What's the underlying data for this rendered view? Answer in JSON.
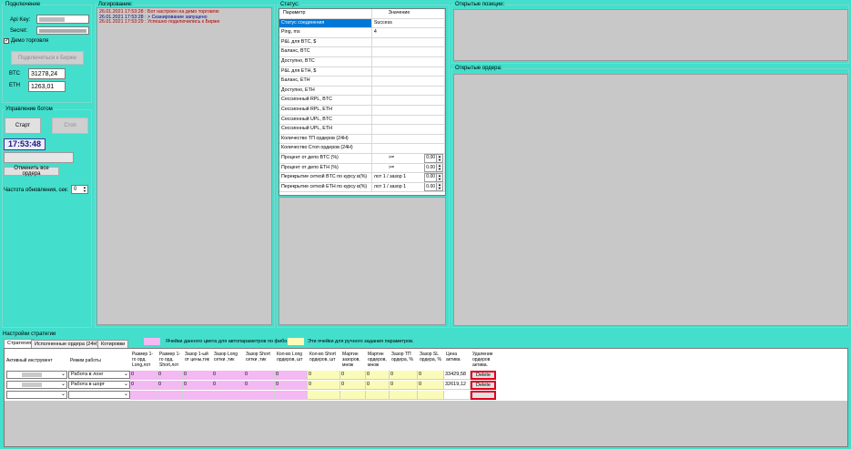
{
  "connection": {
    "title": "Подключение",
    "api_key_label": "Api Key:",
    "secret_label": "Secret:",
    "demo_label": "Демо торговля",
    "connect_button": "Подключиться к Бирже",
    "btc_label": "BTC",
    "btc_value": "31278,24",
    "eth_label": "ETH",
    "eth_value": "1263,01"
  },
  "bot_control": {
    "title": "Управление ботом",
    "start_button": "Старт",
    "stop_button": "Стоп",
    "clock": "17:53:48",
    "cancel_orders_button": "Отменить все ордера",
    "refresh_label": "Частота обновления, сек:",
    "refresh_value": "0"
  },
  "logging": {
    "title": "Логирование:",
    "lines": [
      "26.01.2021 17:53:28 : Бот настроен на демо торговлю",
      "26.01.2021 17:53:28 : > Сканирование запущено",
      "26.01.2021 17:53:29 : Успешно подключились к Бирже"
    ]
  },
  "status": {
    "title": "Статус:",
    "col_param": "Параметр",
    "col_value": "Значение",
    "rows": [
      {
        "param": "Статус соединения",
        "value": "Success",
        "selected": true
      },
      {
        "param": "Ping, ms",
        "value": "4"
      },
      {
        "param": "P&L для BTC, $",
        "value": ""
      },
      {
        "param": "Баланс, BTC",
        "value": ""
      },
      {
        "param": "Доступно, BTC",
        "value": ""
      },
      {
        "param": "P&L для ETH, $",
        "value": ""
      },
      {
        "param": "Баланс, ETH",
        "value": ""
      },
      {
        "param": "Доступно, ETH",
        "value": ""
      },
      {
        "param": "Сессионный RPL, BTC",
        "value": ""
      },
      {
        "param": "Сессионный RPL, ETH",
        "value": ""
      },
      {
        "param": "Сессионный UPL, BTC",
        "value": ""
      },
      {
        "param": "Сессионный UPL, ETH",
        "value": ""
      },
      {
        "param": "Количество ТП ордеров (24Н)",
        "value": ""
      },
      {
        "param": "Количество Стоп ордеров (24Н)",
        "value": ""
      },
      {
        "param": "Процент от депо BTC (%)",
        "value": ">=",
        "spin": "0.00"
      },
      {
        "param": "Процент от депо  ETH (%)",
        "value": ">=",
        "spin": "0.00"
      },
      {
        "param": "Перекрытие сеткой BTC по курсу в(%)",
        "value": "лот 1 / зазор 1",
        "spin": "0.00"
      },
      {
        "param": "Перекрытие сеткой ETH по курсу в(%)",
        "value": "лот 1 / зазор 1",
        "spin": "0.00"
      }
    ]
  },
  "open_positions": {
    "title": "Открытые позиции:"
  },
  "open_orders": {
    "title": "Открытые ордера:"
  },
  "strategy": {
    "title": "Настройки стратегии",
    "tabs": [
      "Стратегия",
      "Исполненные ордера (24H)",
      "Котировки"
    ],
    "legend_pink": "Ячейки данного цвета для автопараметров по фибо.",
    "legend_yellow": "Эти ячейки для ручного задания параметров.",
    "headers": [
      "Активный инструмент",
      "Режим работы",
      "Размер 1-го орд. Long,лот",
      "Размер 1-го орд. Short,лот",
      "Зазор 1-ый от цены,тик",
      "Зазор Long сетки ,тик",
      "Зазор Short сетки ,тик",
      "Кол-во Long ордеров, шт",
      "Кол-во Short ордеров, шт",
      "Мартин зазоров, множ",
      "Мартин ордеров, множ",
      "Зазор ТП ордера, %",
      "Зазор SL ордера, %",
      "Цена актива",
      "Удаление ордеров актива."
    ],
    "rows": [
      {
        "instrument": "",
        "mode": "Работа в лонг",
        "vals": [
          "0",
          "0",
          "0",
          "0",
          "0",
          "0",
          "0",
          "0",
          "0",
          "0",
          "0"
        ],
        "price": "33429,58",
        "delete": "Delete"
      },
      {
        "instrument": "",
        "mode": "Работа в шорт",
        "vals": [
          "0",
          "0",
          "0",
          "0",
          "0",
          "0",
          "0",
          "0",
          "0",
          "0",
          "0"
        ],
        "price": "32619,12",
        "delete": "Delete"
      },
      {
        "instrument": "",
        "mode": "",
        "vals": [
          "",
          "",
          "",
          "",
          "",
          "",
          "",
          "",
          "",
          "",
          ""
        ],
        "price": "",
        "delete": ""
      }
    ]
  },
  "colors": {
    "background": "#43dfcc",
    "pink": "#f4b8f4",
    "yellow": "#fbfbb8",
    "selected": "#0078d7",
    "delete_border": "#e3001b"
  }
}
